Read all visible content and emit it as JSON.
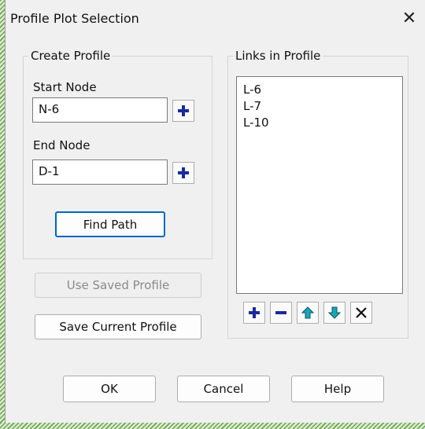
{
  "window": {
    "title": "Profile Plot Selection"
  },
  "create_profile": {
    "legend": "Create Profile",
    "start_node": {
      "label": "Start Node",
      "value": "N-6"
    },
    "end_node": {
      "label": "End Node",
      "value": "D-1"
    },
    "find_path_label": "Find Path"
  },
  "use_saved_label": "Use Saved Profile",
  "save_current_label": "Save Current Profile",
  "links": {
    "legend": "Links in Profile",
    "items": [
      "L-6",
      "L-7",
      "L-10"
    ]
  },
  "footer": {
    "ok": "OK",
    "cancel": "Cancel",
    "help": "Help"
  },
  "icons": {
    "add": "plus-icon",
    "remove": "minus-icon",
    "up": "arrow-up-icon",
    "down": "arrow-down-icon",
    "delete": "x-icon",
    "close": "close-icon"
  },
  "colors": {
    "accent": "#0067c0",
    "plus_icon": "#1b2a9a",
    "arrow_icon": "#1aa6b7"
  }
}
